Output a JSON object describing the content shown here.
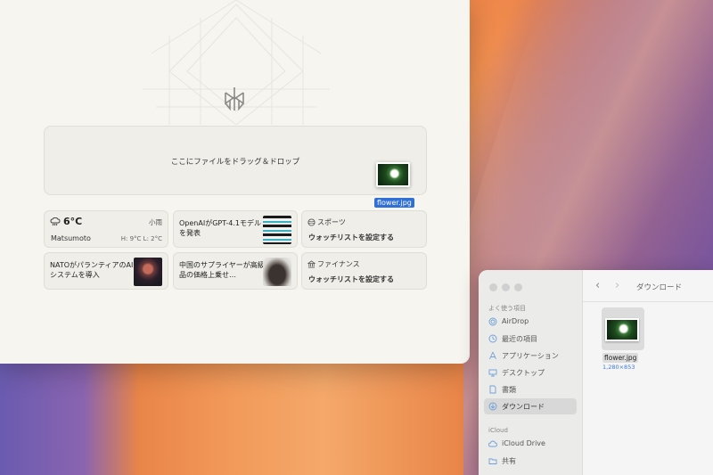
{
  "app": {
    "dropzone_text": "ここにファイルをドラッグ＆ドロップ",
    "drag_file_label": "flower.jpg",
    "weather": {
      "temp": "6°C",
      "condition": "小雨",
      "city": "Matsumoto",
      "high_low": "H: 9°C L: 2°C",
      "icon": "rain-cloud-icon"
    },
    "cards": {
      "news1": "OpenAIがGPT-4.1モデルを発表",
      "news2": "NATOがパランティアのAIシステムを導入",
      "news3": "中国のサプライヤーが高級品の価格上乗せ…",
      "sports_label": "スポーツ",
      "sports_action": "ウォッチリストを設定する",
      "finance_label": "ファイナンス",
      "finance_action": "ウォッチリストを設定する"
    }
  },
  "finder": {
    "title": "ダウンロード",
    "favorites_heading": "よく使う項目",
    "favorites": [
      {
        "label": "AirDrop",
        "icon": "airdrop-icon"
      },
      {
        "label": "最近の項目",
        "icon": "clock-icon"
      },
      {
        "label": "アプリケーション",
        "icon": "applications-icon"
      },
      {
        "label": "デスクトップ",
        "icon": "desktop-icon"
      },
      {
        "label": "書類",
        "icon": "document-icon"
      },
      {
        "label": "ダウンロード",
        "icon": "download-icon",
        "selected": true
      }
    ],
    "icloud_heading": "iCloud",
    "icloud": [
      {
        "label": "iCloud Drive",
        "icon": "cloud-icon"
      },
      {
        "label": "共有",
        "icon": "shared-folder-icon"
      }
    ],
    "file": {
      "name": "flower.jpg",
      "dimensions": "1,280×853"
    }
  }
}
